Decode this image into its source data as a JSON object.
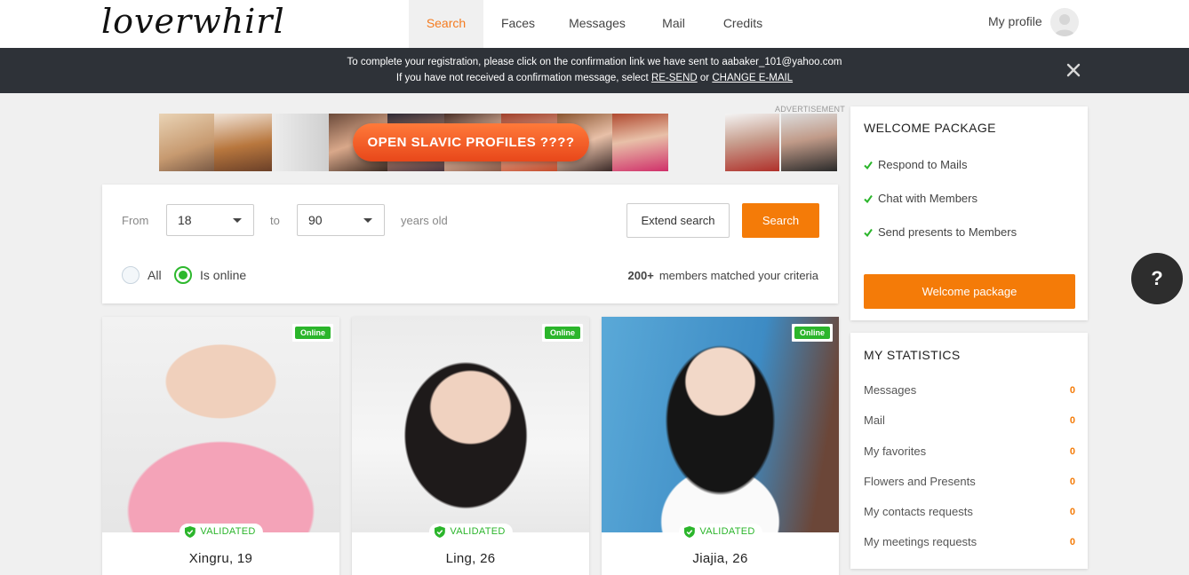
{
  "logo": "loverwhirl",
  "nav": {
    "items": [
      {
        "label": "Search",
        "active": true
      },
      {
        "label": "Faces",
        "active": false
      },
      {
        "label": "Messages",
        "active": false
      },
      {
        "label": "Mail",
        "active": false
      },
      {
        "label": "Credits",
        "active": false
      }
    ],
    "profile_label": "My profile"
  },
  "banner": {
    "line1": "To complete your registration, please click on the confirmation link we have sent to aabaker_101@yahoo.com",
    "line2_prefix": "If you have not received a confirmation message, select",
    "resend": "RE-SEND",
    "or": "or",
    "change_email": "CHANGE E-MAIL"
  },
  "ad": {
    "label": "ADVERTISEMENT",
    "button": "OPEN SLAVIC PROFILES ????"
  },
  "search": {
    "from_label": "From",
    "from_value": "18",
    "to_label": "to",
    "to_value": "90",
    "years_label": "years old",
    "extend_label": "Extend search",
    "search_label": "Search",
    "radio_all": "All",
    "radio_online": "Is online",
    "selected": "Is online",
    "match_count": "200+",
    "match_text": "members matched your criteria"
  },
  "profiles": [
    {
      "name": "Xingru, 19",
      "online": "Online",
      "validated": "VALIDATED"
    },
    {
      "name": "Ling, 26",
      "online": "Online",
      "validated": "VALIDATED"
    },
    {
      "name": "Jiajia, 26",
      "online": "Online",
      "validated": "VALIDATED"
    }
  ],
  "welcome": {
    "title": "WELCOME PACKAGE",
    "items": [
      "Respond to Mails",
      "Chat with Members",
      "Send presents to Members"
    ],
    "button": "Welcome package"
  },
  "stats": {
    "title": "MY STATISTICS",
    "rows": [
      {
        "label": "Messages",
        "value": "0"
      },
      {
        "label": "Mail",
        "value": "0"
      },
      {
        "label": "My favorites",
        "value": "0"
      },
      {
        "label": "Flowers and Presents",
        "value": "0"
      },
      {
        "label": "My contacts requests",
        "value": "0"
      },
      {
        "label": "My meetings requests",
        "value": "0"
      }
    ]
  },
  "help": "?",
  "colors": {
    "accent": "#f47b08",
    "online": "#2bb52b",
    "banner": "#2e3238"
  }
}
